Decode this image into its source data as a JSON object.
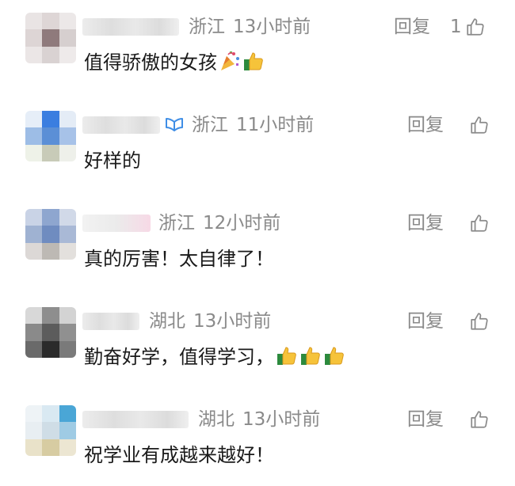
{
  "comments": [
    {
      "location": "浙江",
      "time": "13小时前",
      "reply_label": "回复",
      "like_count": "1",
      "text": "值得骄傲的女孩",
      "emojis": [
        "party-popper",
        "thumbs-up"
      ]
    },
    {
      "location": "浙江",
      "time": "11小时前",
      "reply_label": "回复",
      "like_count": "",
      "text": "好样的",
      "emojis": []
    },
    {
      "location": "浙江",
      "time": "12小时前",
      "reply_label": "回复",
      "like_count": "",
      "text": "真的厉害！太自律了！",
      "emojis": []
    },
    {
      "location": "湖北",
      "time": "13小时前",
      "reply_label": "回复",
      "like_count": "",
      "text": "勤奋好学，值得学习，",
      "emojis": [
        "thumbs-up",
        "thumbs-up",
        "thumbs-up"
      ]
    },
    {
      "location": "湖北",
      "time": "13小时前",
      "reply_label": "回复",
      "like_count": "",
      "text": "祝学业有成越来越好！",
      "emojis": []
    }
  ],
  "colors": {
    "meta_text": "#8a8a8a",
    "comment_text": "#1a1a1a",
    "verified_badge": "#3f8ee6"
  },
  "icons": {
    "like": "thumbs-up-outline-icon",
    "verified": "verified-badge-icon"
  }
}
